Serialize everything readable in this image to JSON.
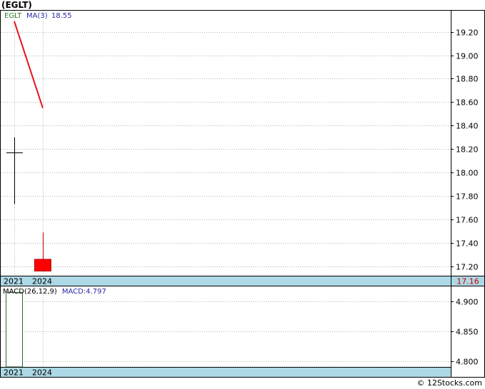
{
  "title": "(EGLT)",
  "colors": {
    "band": "#add8e6",
    "grid": "#b4b4b4",
    "ma_line": "#e8141c",
    "candle_down": "#ff0000",
    "candle_outline": "#b40000",
    "macd_bar_outline": "#2e6b2e",
    "ticker_label": "#2e7d32",
    "indicator_label": "#2a2aa6",
    "last_price_tag": "#ff4444"
  },
  "price_panel": {
    "ticker_label": "EGLT",
    "ma_label": "MA(3)",
    "ma_value": "18.55",
    "last_price": "17.16"
  },
  "macd_panel": {
    "label": "MACD(26,12,9)",
    "value_label": "MACD:4.797"
  },
  "x_labels": [
    "2021",
    "2024"
  ],
  "watermark": "© 12Stocks.com",
  "chart_data": [
    {
      "type": "candlestick",
      "title": "(EGLT)",
      "categories": [
        "2021",
        "2024"
      ],
      "ylim": [
        17.12,
        19.38
      ],
      "yticks": [
        "17.20",
        "17.40",
        "17.60",
        "17.80",
        "18.00",
        "18.20",
        "18.40",
        "18.60",
        "18.80",
        "19.00",
        "19.20"
      ],
      "candles": [
        {
          "x": "2021",
          "open": 18.17,
          "high": 18.3,
          "low": 17.73,
          "close": 18.17,
          "style": "cross"
        },
        {
          "x": "2024",
          "open": 17.26,
          "high": 17.49,
          "low": 17.16,
          "close": 17.16,
          "style": "down"
        }
      ],
      "series": [
        {
          "name": "MA(3)",
          "values": [
            19.29,
            18.55
          ]
        }
      ],
      "grid": true
    },
    {
      "type": "bar",
      "title": "MACD(26,12,9)",
      "categories": [
        "2021",
        "2024"
      ],
      "ylim": [
        4.79,
        4.925
      ],
      "yticks": [
        "4.800",
        "4.850",
        "4.900"
      ],
      "series": [
        {
          "name": "MACD",
          "values": [
            4.915,
            null
          ]
        }
      ],
      "grid": true
    }
  ]
}
